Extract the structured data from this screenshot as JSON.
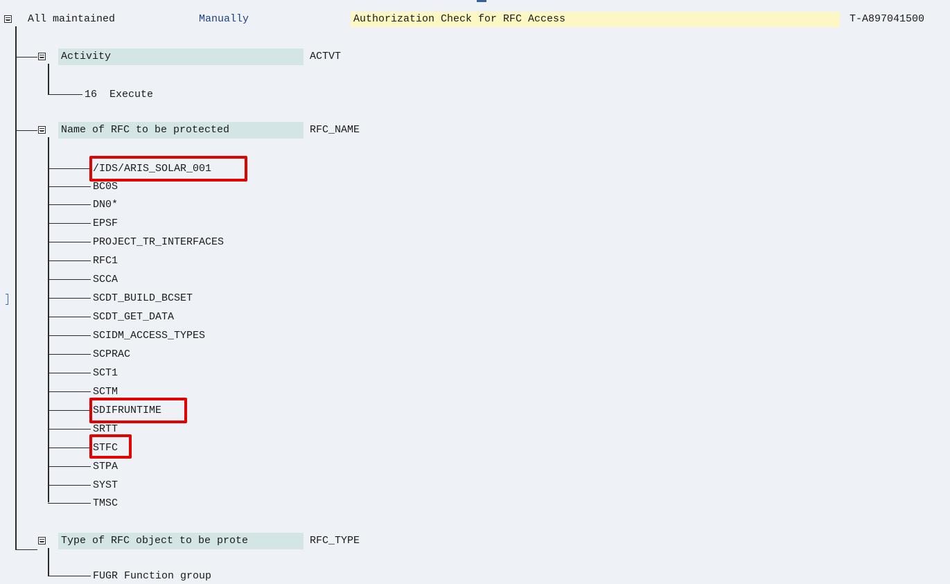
{
  "header": {
    "status": "All maintained",
    "mode": "Manually",
    "title": "Authorization Check for RFC Access",
    "object_id": "T-A897041500"
  },
  "fields": {
    "activity": {
      "label": "Activity",
      "technical": "ACTVT",
      "values": [
        "16  Execute"
      ]
    },
    "rfc_name": {
      "label": "Name of RFC to be protected",
      "technical": "RFC_NAME",
      "values": [
        "/IDS/ARIS_SOLAR_001",
        "BC0S",
        "DN0*",
        "EPSF",
        "PROJECT_TR_INTERFACES",
        "RFC1",
        "SCCA",
        "SCDT_BUILD_BCSET",
        "SCDT_GET_DATA",
        "SCIDM_ACCESS_TYPES",
        "SCPRAC",
        "SCT1",
        "SCTM",
        "SDIFRUNTIME",
        "SRTT",
        "STFC",
        "STPA",
        "SYST",
        "TMSC"
      ]
    },
    "rfc_type": {
      "label": "Type of RFC object to be prote",
      "technical": "RFC_TYPE",
      "values": [
        "FUGR Function group"
      ]
    }
  },
  "highlighted_values": [
    "/IDS/ARIS_SOLAR_001",
    "SDIFRUNTIME",
    "STFC"
  ],
  "colors": {
    "background": "#eef2f6",
    "field_highlight": "#d3e5e4",
    "title_highlight": "#fdf7c3",
    "annotation_box": "#e50000",
    "link_text": "#1f3f8a"
  }
}
